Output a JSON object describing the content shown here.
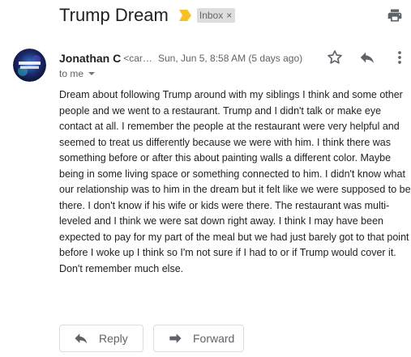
{
  "email": {
    "subject": "Trump Dream",
    "label": "Inbox",
    "label_remove": "×",
    "sender_name": "Jonathan C",
    "sender_email": "<car…",
    "date": "Sun, Jun 5, 8:58 AM (5 days ago)",
    "recipient": "to me",
    "body": "Dream about following Trump around with my siblings I think and some other people and we went to a restaurant. Trump and I didn't talk or make eye contact at all. I remember the people at the restaurant were very helpful and seemed to treat us differently because we were with him. I think there was something before or after this about painting walls a different color. Maybe being in some living space or something connected to him. I didn't know what our relationship was to him in the dream but it felt like we were supposed to be there. I don't know if his wife or kids were there. The restaurant was multi-leveled and I think we were sat down right away. I think I may have been expected to pay for my part of the meal but we had just barely got to that point before I woke up I think so I'm not sure if I had to or if Trump would cover it. Don't remember much else."
  },
  "actions": {
    "reply_label": "Reply",
    "forward_label": "Forward"
  },
  "icons": {
    "importance": "importance-marker-icon",
    "print": "print-icon",
    "star": "star-icon",
    "reply": "reply-icon",
    "more": "more-vert-icon",
    "avatar": "sender-avatar"
  },
  "colors": {
    "importance": "#f6c026",
    "label_bg": "#dddddd",
    "text": "#202124",
    "secondary_text": "#5f6368"
  }
}
